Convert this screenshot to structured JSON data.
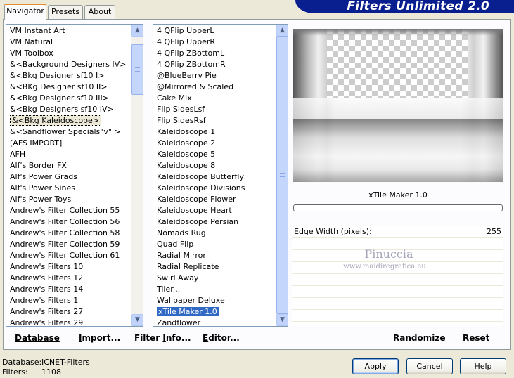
{
  "banner": {
    "title": "Filters Unlimited 2.0"
  },
  "tabs": [
    {
      "label": "Navigator",
      "active": true
    },
    {
      "label": "Presets",
      "active": false
    },
    {
      "label": "About",
      "active": false
    }
  ],
  "categories": {
    "items": [
      "VM Instant Art",
      "VM Natural",
      "VM Toolbox",
      "&<Background Designers IV>",
      "&<Bkg Designer sf10 I>",
      "&<BKg Designer sf10 II>",
      "&<Bkg Designer sf10 III>",
      "&<Bkg Designers sf10 IV>",
      "&<Bkg Kaleidoscope>",
      "&<Sandflower Specials\"v\" >",
      "[AFS IMPORT]",
      "AFH",
      "Alf's Border FX",
      "Alf's Power Grads",
      "Alf's Power Sines",
      "Alf's Power Toys",
      "Andrew's Filter Collection 55",
      "Andrew's Filter Collection 56",
      "Andrew's Filter Collection 58",
      "Andrew's Filter Collection 59",
      "Andrew's Filter Collection 61",
      "Andrew's Filters 10",
      "Andrew's Filters 12",
      "Andrew's Filters 14",
      "Andrew's Filters 1",
      "Andrew's Filters 27",
      "Andrew's Filters 29"
    ],
    "selected_index": 8
  },
  "filters": {
    "items": [
      "4 QFlip UpperL",
      "4 QFlip UpperR",
      "4 QFlip ZBottomL",
      "4 QFlip ZBottomR",
      "@BlueBerry Pie",
      "@Mirrored & Scaled",
      "Cake Mix",
      "Flip SidesLsf",
      "Flip SidesRsf",
      "Kaleidoscope 1",
      "Kaleidoscope 2",
      "Kaleidoscope 5",
      "Kaleidoscope 8",
      "Kaleidoscope Butterfly",
      "Kaleidoscope Divisions",
      "Kaleidoscope Flower",
      "Kaleidoscope Heart",
      "Kaleidoscope Persian",
      "Nomads Rug",
      "Quad Flip",
      "Radial Mirror",
      "Radial Replicate",
      "Swirl Away",
      "Tiler...",
      "Wallpaper Deluxe",
      "xTile Maker 1.0",
      "Zandflower"
    ],
    "selected_index": 25
  },
  "preview": {
    "filter_name": "xTile Maker 1.0"
  },
  "params": [
    {
      "label": "Edge Width (pixels):",
      "value": "255"
    }
  ],
  "watermark": {
    "line1": "Pinuccia",
    "line2": "www.maidiregrafica.eu"
  },
  "toolbar": {
    "database": "Database",
    "import_u": "I",
    "import_rest": "mport...",
    "filterinfo_pre": "Filter ",
    "filterinfo_u": "I",
    "filterinfo_rest": "nfo...",
    "editor_u": "E",
    "editor_rest": "ditor...",
    "randomize": "Randomize",
    "reset": "Reset"
  },
  "status": {
    "database_label": "Database:",
    "database_value": "ICNET-Filters",
    "filters_label": "Filters:",
    "filters_value": "1108"
  },
  "buttons": {
    "apply": "Apply",
    "cancel": "Cancel",
    "help": "Help"
  }
}
